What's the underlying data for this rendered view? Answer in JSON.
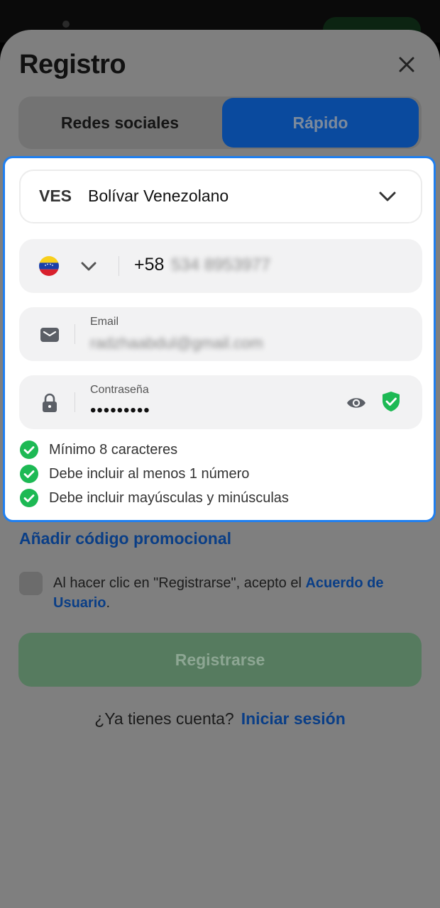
{
  "header": {
    "title": "Registro",
    "close_icon": "close-icon"
  },
  "tabs": [
    {
      "label": "Redes sociales",
      "active": false
    },
    {
      "label": "Rápido",
      "active": true
    }
  ],
  "currency": {
    "code": "VES",
    "name": "Bolívar Venezolano"
  },
  "phone": {
    "prefix": "+58",
    "number": "534 8953977",
    "flag": "venezuela-flag-icon"
  },
  "email": {
    "label": "Email",
    "value": "radzhaabdul@gmail.com"
  },
  "password": {
    "label": "Contraseña",
    "value": "•••••••••"
  },
  "password_rules": [
    {
      "text": "Mínimo 8 caracteres",
      "ok": true
    },
    {
      "text": "Debe incluir al menos 1 número",
      "ok": true
    },
    {
      "text": "Debe incluir mayúsculas y minúsculas",
      "ok": true
    }
  ],
  "promo_link": "Añadir código promocional",
  "agreement": {
    "text": "Al hacer clic en \"Registrarse\", acepto el ",
    "link": "Acuerdo de Usuario",
    "suffix": ".",
    "checked": false
  },
  "register_button": "Registrarse",
  "login": {
    "question": "¿Ya tienes cuenta?",
    "link": "Iniciar sesión"
  },
  "colors": {
    "accent": "#1f7ff0",
    "success": "#1db954",
    "link": "#0a3e86"
  }
}
